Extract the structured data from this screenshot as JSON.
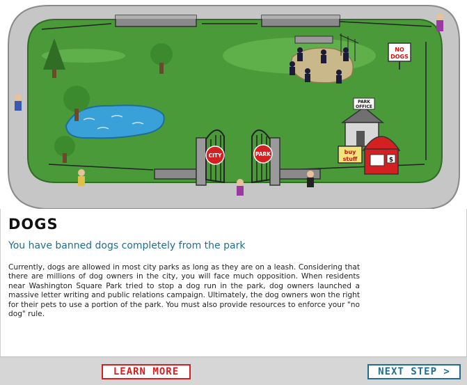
{
  "scene": {
    "gate_left_sign": "CITY",
    "gate_right_sign": "PARK",
    "no_dogs_sign": [
      "NO",
      "DOGS"
    ],
    "park_office_sign": [
      "PARK",
      "OFFICE"
    ],
    "buy_stuff_sign": [
      "buy",
      "stuff"
    ],
    "tent_sign": "$"
  },
  "content": {
    "heading": "DOGS",
    "subtitle": "You have banned dogs completely from the park",
    "body": "Currently, dogs are allowed in most city parks as long as they are on a leash. Considering that there are millions of dog owners in the city, you will face much opposition. When residents near Washington Square Park tried to stop a dog run in the park, dog owners launched a massive letter writing and public relations campaign. Ultimately, the dog owners won the right for their pets to use a portion of the park. You must also provide resources to enforce your \"no dog\" rule."
  },
  "footer": {
    "learn_more_label": "LEARN MORE",
    "next_step_label": "NEXT STEP >"
  },
  "colors": {
    "grass": "#4a9a3a",
    "path": "#c8c8c8",
    "pond": "#3aa0d8",
    "heading_teal": "#1f6f8b",
    "learn_red": "#d42020"
  }
}
